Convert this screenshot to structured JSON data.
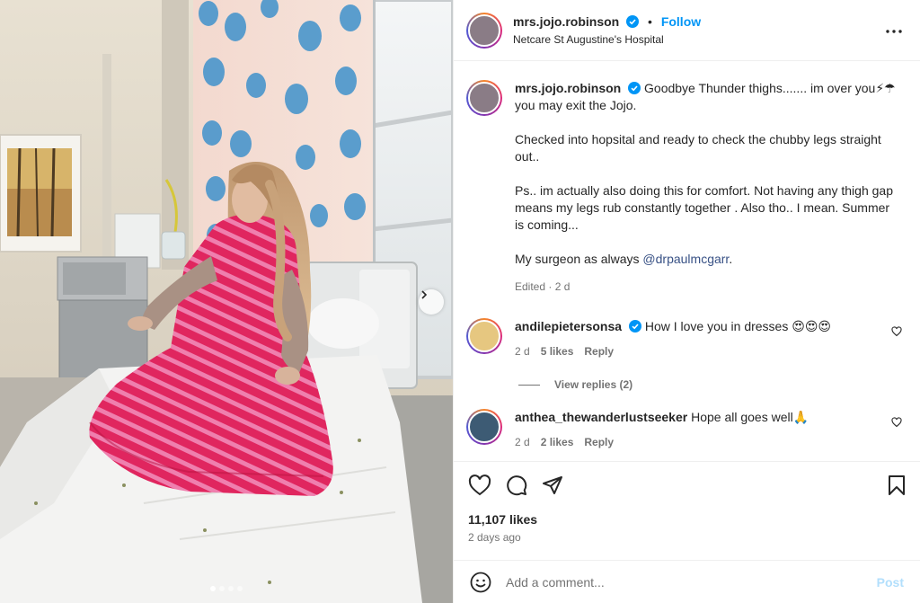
{
  "post": {
    "username": "mrs.jojo.robinson",
    "separator": "•",
    "follow_label": "Follow",
    "location": "Netcare St Augustine's Hospital",
    "more_icon": "more-horizontal-icon"
  },
  "caption": {
    "username": "mrs.jojo.robinson",
    "line1": "Goodbye Thunder thighs....... im over you⚡☂ you may exit the Jojo.",
    "line2": "Checked into hopsital and ready to check the chubby legs straight out..",
    "line3": "Ps.. im actually also doing this for comfort. Not having any thigh gap means my legs rub constantly together . Also tho.. I mean. Summer is coming...",
    "line4_prefix": "My surgeon as always ",
    "line4_mention": "@drpaulmcgarr",
    "line4_suffix": ".",
    "meta": "Edited · 2 d"
  },
  "comments": [
    {
      "username": "andilepietersonsa",
      "text": "How I love you in dresses 😍😍😍",
      "age": "2 d",
      "likes": "5 likes",
      "reply_label": "Reply",
      "view_replies": "View replies (2)"
    },
    {
      "username": "anthea_thewanderlustseeker",
      "text": "Hope all goes well🙏",
      "age": "2 d",
      "likes": "2 likes",
      "reply_label": "Reply"
    }
  ],
  "actions": {
    "icons": [
      "heart-icon",
      "comment-icon",
      "share-icon",
      "bookmark-icon"
    ],
    "likes": "11,107 likes",
    "time": "2 days ago"
  },
  "add_comment": {
    "placeholder": "Add a comment...",
    "post_label": "Post"
  },
  "carousel": {
    "slide_count": 4,
    "active_index": 0
  },
  "colors": {
    "link_blue": "#0095f6",
    "verified_blue": "#0095f6",
    "muted_text": "#737373",
    "post_disabled": "#b2dffc",
    "mention": "#385185"
  }
}
